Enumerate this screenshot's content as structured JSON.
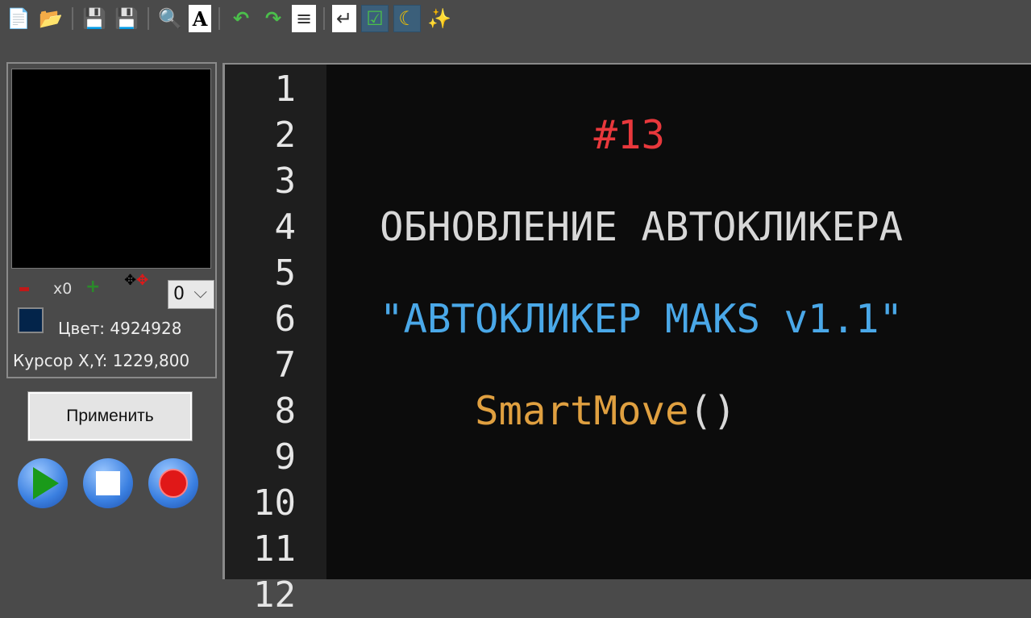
{
  "toolbar": {
    "icons": [
      "new-file",
      "open-folder",
      "save",
      "save-all",
      "find",
      "font",
      "undo",
      "redo",
      "align",
      "word-wrap",
      "checklist",
      "dark-mode",
      "magic-wand"
    ],
    "active": [
      "checklist",
      "dark-mode"
    ]
  },
  "panel": {
    "zoom_label": "x0",
    "select_value": "0",
    "select_arrow": "⌵",
    "color_label": "Цвет: 4924928",
    "color_swatch": "#03244a",
    "cursor_label": "Курсор X,Y: 1229,800",
    "apply_label": "Применить"
  },
  "editor": {
    "line_numbers": [
      "1",
      "2",
      "3",
      "4",
      "5",
      "6",
      "7",
      "8",
      "9",
      "10",
      "11",
      "12"
    ],
    "lines": [
      {
        "line": 2,
        "text": "         #13",
        "color": "#e8383c"
      },
      {
        "line": 4,
        "text": "ОБНОВЛЕНИЕ АВТОКЛИКЕРА",
        "color": "#d8d8d8"
      },
      {
        "line": 6,
        "text": "\"АВТОКЛИКЕР MAKS v1.1\"",
        "color": "#4aa8e8"
      },
      {
        "line": 8,
        "text": "    SmartMove",
        "color": "#e0a040",
        "suffix": "()",
        "suffix_color": "#d8d8d8"
      }
    ]
  }
}
